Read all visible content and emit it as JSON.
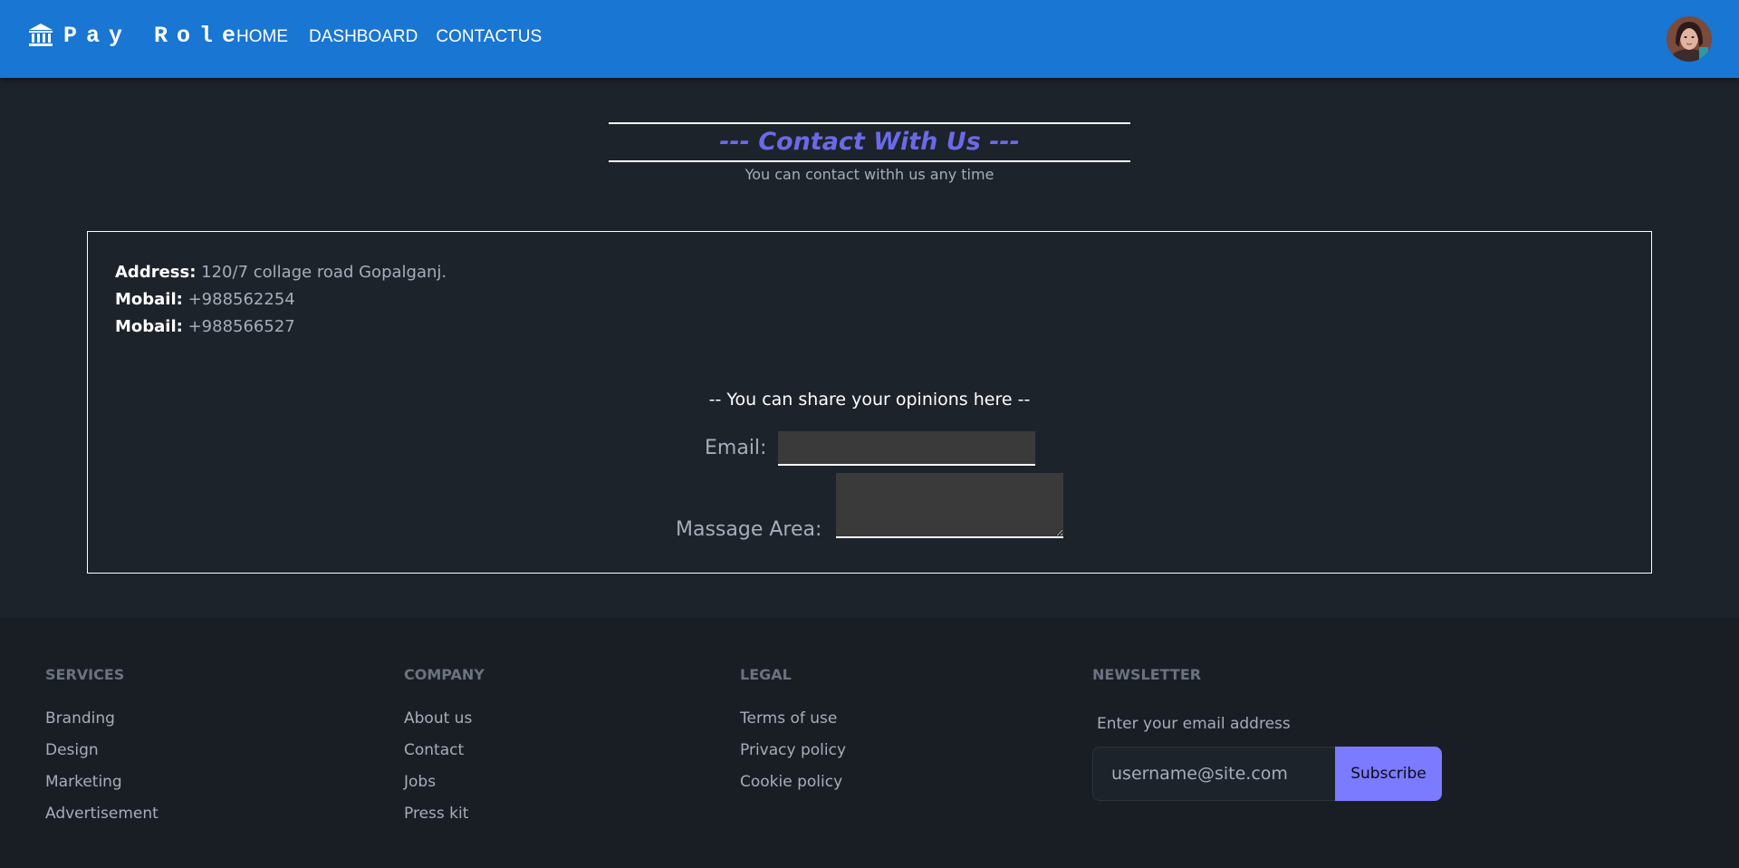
{
  "navbar": {
    "brand_name": "Pay Role",
    "brand_icon": "bank-icon",
    "links": [
      "HOME",
      "DASHBOARD",
      "CONTACTUS"
    ],
    "avatar": "user-avatar"
  },
  "contact_header": {
    "title": "--- Contact With Us ---",
    "subtitle": "You can contact withh us any time",
    "title_color": "#6a6ae8"
  },
  "contact_info": {
    "address_label": "Address:",
    "address_value": "120/7 collage road Gopalganj.",
    "mobile1_label": "Mobail:",
    "mobile1_value": "+988562254",
    "mobile2_label": "Mobail:",
    "mobile2_value": "+988566527"
  },
  "opinion_form": {
    "title": "-- You can share your opinions here --",
    "email_label": "Email:",
    "email_value": "",
    "message_label": "Massage Area:",
    "message_value": ""
  },
  "footer": {
    "services": {
      "title": "SERVICES",
      "links": [
        "Branding",
        "Design",
        "Marketing",
        "Advertisement"
      ]
    },
    "company": {
      "title": "COMPANY",
      "links": [
        "About us",
        "Contact",
        "Jobs",
        "Press kit"
      ]
    },
    "legal": {
      "title": "LEGAL",
      "links": [
        "Terms of use",
        "Privacy policy",
        "Cookie policy"
      ]
    },
    "newsletter": {
      "title": "NEWSLETTER",
      "label": "Enter your email address",
      "placeholder": "username@site.com",
      "button_label": "Subscribe"
    }
  },
  "colors": {
    "navbar_bg": "#1976d2",
    "page_bg": "#1d232a",
    "footer_bg": "#191e24",
    "subscribe_bg": "#7b7bff"
  }
}
